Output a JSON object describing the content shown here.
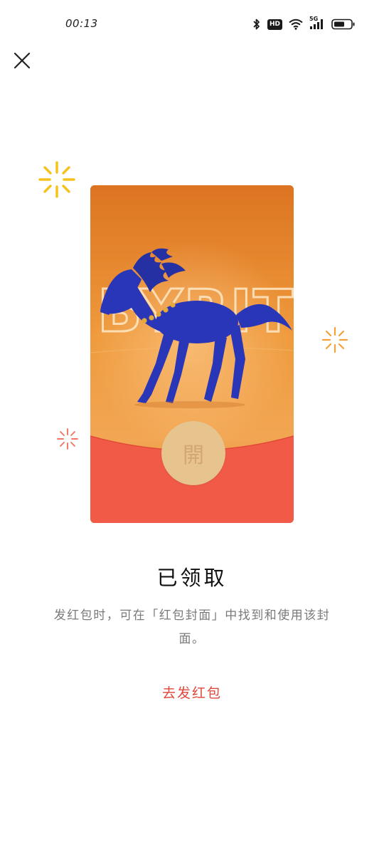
{
  "status_bar": {
    "time": "00:13",
    "icons": [
      "bluetooth-icon",
      "hd-icon",
      "wifi-icon",
      "5g-signal-icon",
      "battery-icon"
    ],
    "hd_label": "HD",
    "network_label": "5G"
  },
  "nav": {
    "close_icon": "close-icon"
  },
  "envelope": {
    "open_label": "開",
    "cover_text": "BYRIT",
    "colors": {
      "cover_orange": "#e88a2a",
      "horse_blue": "#2a36b8",
      "envelope_red": "#f05a46",
      "button_gold": "#e7c38d"
    }
  },
  "result": {
    "title": "已领取",
    "description": "发红包时，可在「红包封面」中找到和使用该封面。",
    "send_link": "去发红包"
  }
}
